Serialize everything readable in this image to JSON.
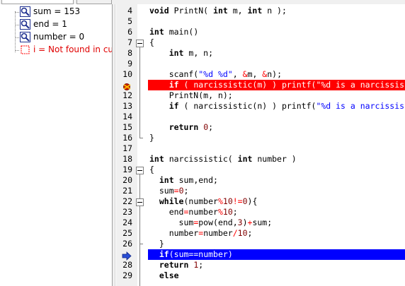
{
  "watch": {
    "items": [
      {
        "text": "sum = 153",
        "icon": "watch-variable-icon",
        "error": false
      },
      {
        "text": "end = 1",
        "icon": "watch-variable-icon",
        "error": false
      },
      {
        "text": "number = 0",
        "icon": "watch-variable-icon",
        "error": false
      },
      {
        "text": "i = Not found in curr",
        "icon": "watch-variable-icon",
        "error": true
      }
    ]
  },
  "editor": {
    "lines": [
      {
        "n": "4",
        "code": "void PrintN( int m, int n );"
      },
      {
        "n": "5",
        "code": ""
      },
      {
        "n": "6",
        "code": "int main()"
      },
      {
        "n": "7",
        "code": "{"
      },
      {
        "n": "8",
        "code": "    int m, n;"
      },
      {
        "n": "9",
        "code": ""
      },
      {
        "n": "10",
        "code": "    scanf(\"%d %d\", &m, &n);"
      },
      {
        "n": "11",
        "code": "    if ( narcissistic(m) ) printf(\"%d is a narcissis"
      },
      {
        "n": "12",
        "code": "    PrintN(m, n);"
      },
      {
        "n": "13",
        "code": "    if ( narcissistic(n) ) printf(\"%d is a narcissis"
      },
      {
        "n": "14",
        "code": ""
      },
      {
        "n": "15",
        "code": "    return 0;"
      },
      {
        "n": "16",
        "code": "}"
      },
      {
        "n": "17",
        "code": ""
      },
      {
        "n": "18",
        "code": "int narcissistic( int number )"
      },
      {
        "n": "19",
        "code": "{"
      },
      {
        "n": "20",
        "code": "  int sum,end;"
      },
      {
        "n": "21",
        "code": "  sum=0;"
      },
      {
        "n": "22",
        "code": "  while(number%10!=0){"
      },
      {
        "n": "23",
        "code": "    end=number%10;"
      },
      {
        "n": "24",
        "code": "      sum=pow(end,3)+sum;"
      },
      {
        "n": "25",
        "code": "    number=number/10;"
      },
      {
        "n": "26",
        "code": "  }"
      },
      {
        "n": "27",
        "code": "  if(sum==number)"
      },
      {
        "n": "28",
        "code": "  return 1;"
      },
      {
        "n": "29",
        "code": "  else"
      }
    ],
    "breakpoint_line": "11",
    "current_line": "27",
    "colors": {
      "breakpoint": "#ff0000",
      "current": "#0000ff",
      "keyword": "#000000",
      "string": "#0000ff",
      "operator": "#ff0000",
      "number": "#800000"
    }
  }
}
